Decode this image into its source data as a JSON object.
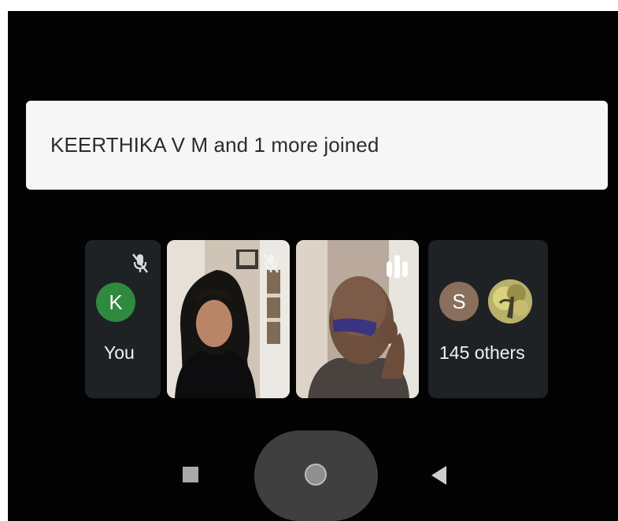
{
  "notification": {
    "text": "KEERTHIKA V M and 1 more joined"
  },
  "participants": {
    "self": {
      "avatar_letter": "K",
      "label": "You",
      "avatar_color": "#2f8a3f",
      "mic_state": "muted"
    },
    "video_tile_1": {
      "mic_state": "muted"
    },
    "video_tile_2": {
      "speaking_indicator": "active"
    },
    "others": {
      "avatar_letter": "S",
      "label": "145 others",
      "avatar_color": "#8a6f5d"
    }
  },
  "icons": {
    "mic_off": "mic-off-icon",
    "speaking": "audio-level-icon",
    "recents": "square-icon",
    "home": "circle-icon",
    "back": "triangle-back-icon"
  },
  "navigation": {
    "buttons": [
      "recents",
      "home",
      "back"
    ]
  }
}
